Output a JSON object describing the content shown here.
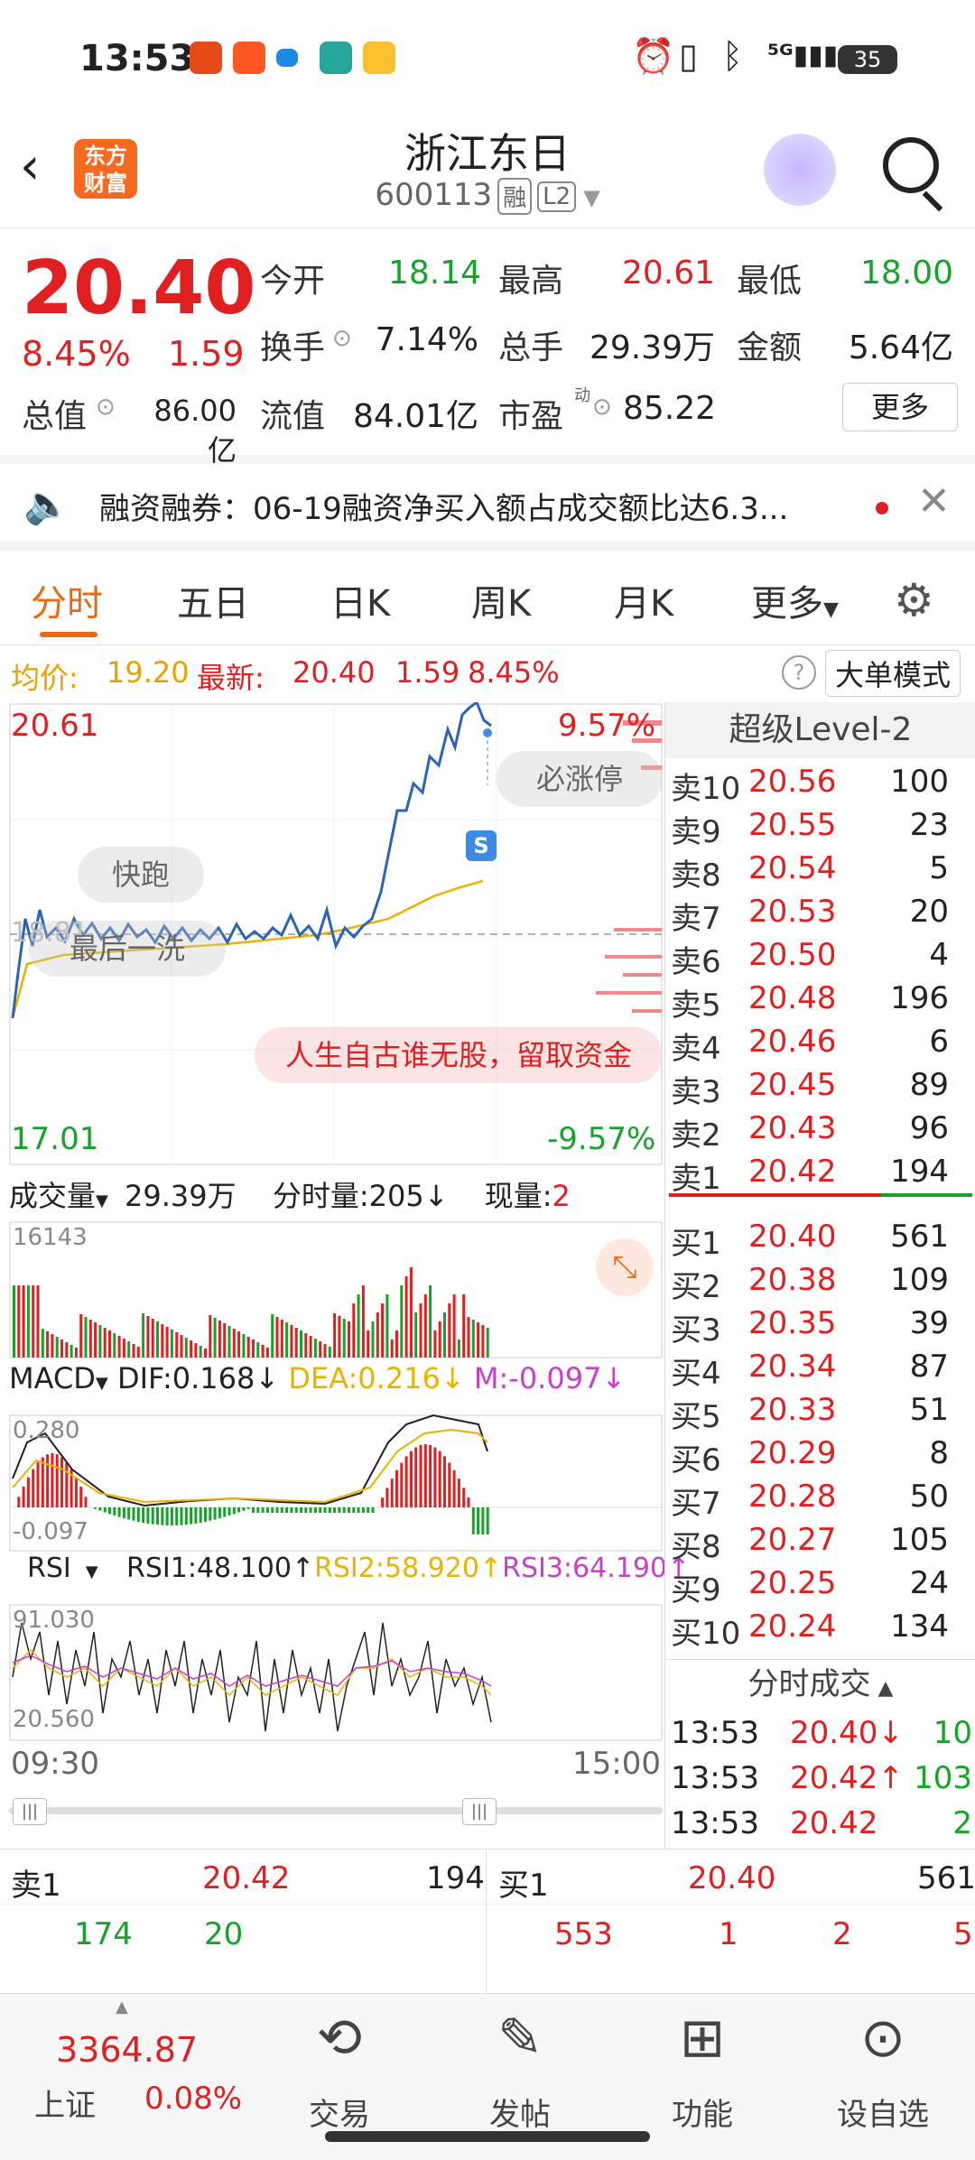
{
  "status": {
    "time": "13:53",
    "battery": "35"
  },
  "header": {
    "brand": "东方\n财富",
    "title": "浙江东日",
    "code": "600113",
    "tag1": "融",
    "tag2": "L2"
  },
  "quote": {
    "price": "20.40",
    "pct": "8.45%",
    "chg": "1.59",
    "open_label": "今开",
    "open": "18.14",
    "high_label": "最高",
    "high": "20.61",
    "low_label": "最低",
    "low": "18.00",
    "turnover_label": "换手",
    "turnover": "7.14%",
    "vol_label": "总手",
    "vol": "29.39万",
    "amount_label": "金额",
    "amount": "5.64亿",
    "mktcap_label": "总值",
    "mktcap": "86.00亿",
    "float_label": "流值",
    "float": "84.01亿",
    "pe_label": "市盈",
    "pe_sup": "动",
    "pe": "85.22",
    "more": "更多"
  },
  "notice": {
    "text": "融资融券：06-19融资净买入额占成交额比达6.3..."
  },
  "tabs": [
    "分时",
    "五日",
    "日K",
    "周K",
    "月K",
    "更多"
  ],
  "info": {
    "avg_label": "均价:",
    "avg": "19.20",
    "last_label": "最新:",
    "last": "20.40",
    "chg": "1.59",
    "pct": "8.45%",
    "mode": "大单模式"
  },
  "chart": {
    "ytop": "20.61",
    "pcttop": "9.57%",
    "ybot": "17.01",
    "pctbot": "-9.57%",
    "mid": "18.81",
    "pill1": "快跑",
    "pill2": "最后一洗",
    "pill3": "必涨停",
    "pill4": "人生自古谁无股，留取资金",
    "vol_title": "成交量",
    "vol_total": "29.39万",
    "vol_min": "分时量:205↓",
    "vol_now_label": "现量:",
    "vol_now": "2",
    "vol_max": "16143",
    "macd_title": "MACD",
    "dif": "DIF:0.168↓",
    "dea": "DEA:0.216↓",
    "m": "M:-0.097↓",
    "macd_top": "0.280",
    "macd_bot": "-0.097",
    "rsi_title": "RSI",
    "rsi1": "RSI1:48.100↑",
    "rsi2": "RSI2:58.920↑",
    "rsi3": "RSI3:64.190↑",
    "rsi_top": "91.030",
    "rsi_bot": "20.560",
    "t_start": "09:30",
    "t_end": "15:00"
  },
  "level2": {
    "title": "超级Level-2",
    "asks": [
      {
        "label": "卖10",
        "price": "20.56",
        "qty": "100"
      },
      {
        "label": "卖9",
        "price": "20.55",
        "qty": "23"
      },
      {
        "label": "卖8",
        "price": "20.54",
        "qty": "5"
      },
      {
        "label": "卖7",
        "price": "20.53",
        "qty": "20"
      },
      {
        "label": "卖6",
        "price": "20.50",
        "qty": "4"
      },
      {
        "label": "卖5",
        "price": "20.48",
        "qty": "196"
      },
      {
        "label": "卖4",
        "price": "20.46",
        "qty": "6"
      },
      {
        "label": "卖3",
        "price": "20.45",
        "qty": "89"
      },
      {
        "label": "卖2",
        "price": "20.43",
        "qty": "96"
      },
      {
        "label": "卖1",
        "price": "20.42",
        "qty": "194"
      }
    ],
    "bids": [
      {
        "label": "买1",
        "price": "20.40",
        "qty": "561"
      },
      {
        "label": "买2",
        "price": "20.38",
        "qty": "109"
      },
      {
        "label": "买3",
        "price": "20.35",
        "qty": "39"
      },
      {
        "label": "买4",
        "price": "20.34",
        "qty": "87"
      },
      {
        "label": "买5",
        "price": "20.33",
        "qty": "51"
      },
      {
        "label": "买6",
        "price": "20.29",
        "qty": "8"
      },
      {
        "label": "买7",
        "price": "20.28",
        "qty": "50"
      },
      {
        "label": "买8",
        "price": "20.27",
        "qty": "105"
      },
      {
        "label": "买9",
        "price": "20.25",
        "qty": "24"
      },
      {
        "label": "买10",
        "price": "20.24",
        "qty": "134"
      }
    ],
    "ticks_title": "分时成交",
    "ticks": [
      {
        "time": "13:53",
        "price": "20.40↓",
        "qty": "10"
      },
      {
        "time": "13:53",
        "price": "20.42↑",
        "qty": "103"
      },
      {
        "time": "13:53",
        "price": "20.42",
        "qty": "2"
      }
    ]
  },
  "bottom": {
    "ask_label": "卖1",
    "ask_price": "20.42",
    "ask_qty": "194",
    "ask_a": "174",
    "ask_b": "20",
    "bid_label": "买1",
    "bid_price": "20.40",
    "bid_qty": "561",
    "bid_a": "553",
    "bid_b": "1",
    "bid_c": "2",
    "bid_d": "5"
  },
  "nav": {
    "index_val": "3364.87",
    "index_name": "上证",
    "index_pct": "0.08%",
    "trade": "交易",
    "post": "发帖",
    "func": "功能",
    "watch": "设自选"
  }
}
